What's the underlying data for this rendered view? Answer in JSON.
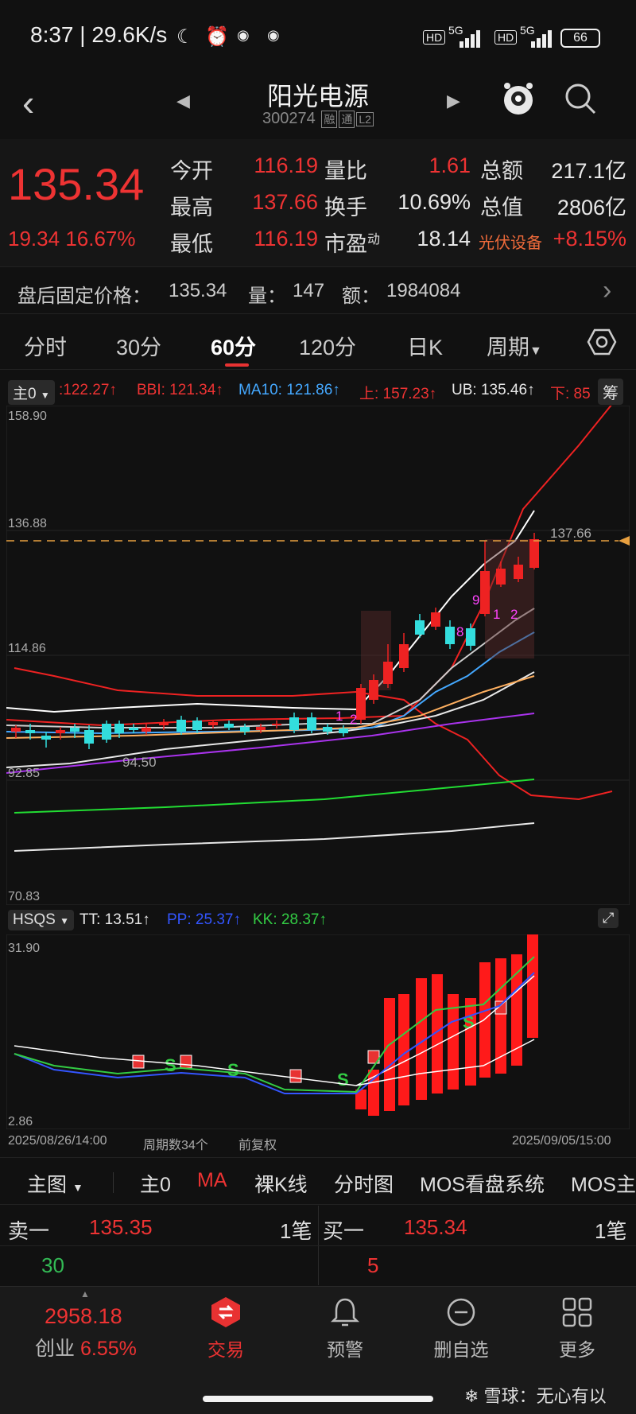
{
  "status_bar": {
    "time": "8:37",
    "speed": "29.6K/s",
    "battery": "66",
    "hd1": "HD",
    "hd2": "HD",
    "net1": "5G",
    "net2": "5G"
  },
  "header": {
    "title": "阳光电源",
    "code": "300274",
    "tags": [
      "融",
      "通",
      "L2"
    ]
  },
  "quote": {
    "price": "135.34",
    "change": "19.34",
    "change_pct": "16.67%",
    "labels": {
      "open": "今开",
      "high": "最高",
      "low": "最低",
      "vol_ratio": "量比",
      "turnover": "换手",
      "pe": "市盈",
      "pe_sup": "动",
      "amount": "总额",
      "mktcap": "总值"
    },
    "open": "116.19",
    "high": "137.66",
    "low": "116.19",
    "vol_ratio": "1.61",
    "turnover": "10.69%",
    "pe": "18.14",
    "amount": "217.1亿",
    "mktcap": "2806亿",
    "sector": "光伏设备",
    "sector_pct": "+8.15%"
  },
  "after_hours": {
    "label": "盘后固定价格：",
    "price": "135.34",
    "vol_label": "量：",
    "vol": "147",
    "amt_label": "额：",
    "amt": "1984084"
  },
  "tabs": [
    "分时",
    "30分",
    "60分",
    "120分",
    "日K",
    "周期"
  ],
  "legend": {
    "selector": "主0",
    "items": [
      {
        "text": ":122.27↑",
        "color": "#ee3333"
      },
      {
        "text": "BBI: 121.34↑",
        "color": "#ee3333"
      },
      {
        "text": "MA10: 121.86↑",
        "color": "#44a8ff"
      },
      {
        "text": "上: 157.23↑",
        "color": "#ee3333"
      },
      {
        "text": "UB: 135.46↑",
        "color": "#e8e8e8"
      },
      {
        "text": "下: 85",
        "color": "#ee3333"
      }
    ],
    "chip": "筹"
  },
  "main_axis": {
    "top": "158.90",
    "mid": "136.88",
    "low1": "114.86",
    "low2": "92.85",
    "bottom": "70.83",
    "hi_mark": "137.66",
    "lo_mark": "94.50"
  },
  "sub_legend": {
    "selector": "HSQS",
    "items": [
      {
        "text": "TT: 13.51↑",
        "color": "#e8e8e8"
      },
      {
        "text": "PP: 25.37↑",
        "color": "#3355ff"
      },
      {
        "text": "KK: 28.37↑",
        "color": "#33cc44"
      }
    ]
  },
  "sub_axis": {
    "top": "31.90",
    "bottom": "2.86"
  },
  "footer_axis": {
    "start": "2025/08/26/14:00",
    "period_count": "周期数34个",
    "adjust": "前复权",
    "end": "2025/09/05/15:00"
  },
  "signals": {
    "n1": "1",
    "n2": "2",
    "n8": "8",
    "n9": "9",
    "n1b": "1",
    "n2b": "2"
  },
  "indicator_tabs": [
    "主图",
    "主0",
    "MA",
    "裸K线",
    "分时图",
    "MOS看盘系统",
    "MOS主"
  ],
  "orderbook": {
    "sell_label": "卖一",
    "sell_price": "135.35",
    "sell_count": "1笔",
    "sell_vol": "30",
    "buy_label": "买一",
    "buy_price": "135.34",
    "buy_count": "1笔",
    "buy_vol": "5"
  },
  "bottom_nav": {
    "index_value": "2958.18",
    "index_name": "创业",
    "index_pct": "6.55%",
    "items": [
      "交易",
      "预警",
      "删自选",
      "更多"
    ]
  },
  "watermark": "雪球：无心有以",
  "colors": {
    "up": "#ee3333",
    "down": "#33bb55",
    "accent": "#e83232",
    "bg": "#111111"
  }
}
